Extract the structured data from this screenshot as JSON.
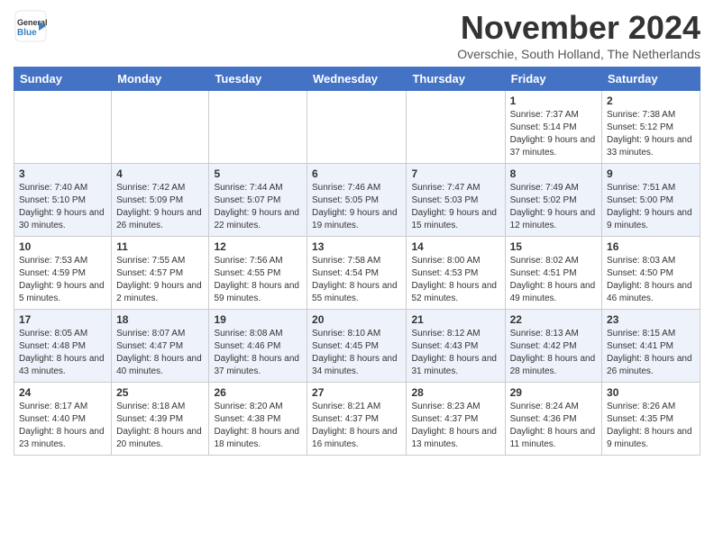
{
  "header": {
    "logo_general": "General",
    "logo_blue": "Blue",
    "month_title": "November 2024",
    "subtitle": "Overschie, South Holland, The Netherlands"
  },
  "days_of_week": [
    "Sunday",
    "Monday",
    "Tuesday",
    "Wednesday",
    "Thursday",
    "Friday",
    "Saturday"
  ],
  "weeks": [
    [
      {
        "day": "",
        "info": ""
      },
      {
        "day": "",
        "info": ""
      },
      {
        "day": "",
        "info": ""
      },
      {
        "day": "",
        "info": ""
      },
      {
        "day": "",
        "info": ""
      },
      {
        "day": "1",
        "info": "Sunrise: 7:37 AM\nSunset: 5:14 PM\nDaylight: 9 hours and 37 minutes."
      },
      {
        "day": "2",
        "info": "Sunrise: 7:38 AM\nSunset: 5:12 PM\nDaylight: 9 hours and 33 minutes."
      }
    ],
    [
      {
        "day": "3",
        "info": "Sunrise: 7:40 AM\nSunset: 5:10 PM\nDaylight: 9 hours and 30 minutes."
      },
      {
        "day": "4",
        "info": "Sunrise: 7:42 AM\nSunset: 5:09 PM\nDaylight: 9 hours and 26 minutes."
      },
      {
        "day": "5",
        "info": "Sunrise: 7:44 AM\nSunset: 5:07 PM\nDaylight: 9 hours and 22 minutes."
      },
      {
        "day": "6",
        "info": "Sunrise: 7:46 AM\nSunset: 5:05 PM\nDaylight: 9 hours and 19 minutes."
      },
      {
        "day": "7",
        "info": "Sunrise: 7:47 AM\nSunset: 5:03 PM\nDaylight: 9 hours and 15 minutes."
      },
      {
        "day": "8",
        "info": "Sunrise: 7:49 AM\nSunset: 5:02 PM\nDaylight: 9 hours and 12 minutes."
      },
      {
        "day": "9",
        "info": "Sunrise: 7:51 AM\nSunset: 5:00 PM\nDaylight: 9 hours and 9 minutes."
      }
    ],
    [
      {
        "day": "10",
        "info": "Sunrise: 7:53 AM\nSunset: 4:59 PM\nDaylight: 9 hours and 5 minutes."
      },
      {
        "day": "11",
        "info": "Sunrise: 7:55 AM\nSunset: 4:57 PM\nDaylight: 9 hours and 2 minutes."
      },
      {
        "day": "12",
        "info": "Sunrise: 7:56 AM\nSunset: 4:55 PM\nDaylight: 8 hours and 59 minutes."
      },
      {
        "day": "13",
        "info": "Sunrise: 7:58 AM\nSunset: 4:54 PM\nDaylight: 8 hours and 55 minutes."
      },
      {
        "day": "14",
        "info": "Sunrise: 8:00 AM\nSunset: 4:53 PM\nDaylight: 8 hours and 52 minutes."
      },
      {
        "day": "15",
        "info": "Sunrise: 8:02 AM\nSunset: 4:51 PM\nDaylight: 8 hours and 49 minutes."
      },
      {
        "day": "16",
        "info": "Sunrise: 8:03 AM\nSunset: 4:50 PM\nDaylight: 8 hours and 46 minutes."
      }
    ],
    [
      {
        "day": "17",
        "info": "Sunrise: 8:05 AM\nSunset: 4:48 PM\nDaylight: 8 hours and 43 minutes."
      },
      {
        "day": "18",
        "info": "Sunrise: 8:07 AM\nSunset: 4:47 PM\nDaylight: 8 hours and 40 minutes."
      },
      {
        "day": "19",
        "info": "Sunrise: 8:08 AM\nSunset: 4:46 PM\nDaylight: 8 hours and 37 minutes."
      },
      {
        "day": "20",
        "info": "Sunrise: 8:10 AM\nSunset: 4:45 PM\nDaylight: 8 hours and 34 minutes."
      },
      {
        "day": "21",
        "info": "Sunrise: 8:12 AM\nSunset: 4:43 PM\nDaylight: 8 hours and 31 minutes."
      },
      {
        "day": "22",
        "info": "Sunrise: 8:13 AM\nSunset: 4:42 PM\nDaylight: 8 hours and 28 minutes."
      },
      {
        "day": "23",
        "info": "Sunrise: 8:15 AM\nSunset: 4:41 PM\nDaylight: 8 hours and 26 minutes."
      }
    ],
    [
      {
        "day": "24",
        "info": "Sunrise: 8:17 AM\nSunset: 4:40 PM\nDaylight: 8 hours and 23 minutes."
      },
      {
        "day": "25",
        "info": "Sunrise: 8:18 AM\nSunset: 4:39 PM\nDaylight: 8 hours and 20 minutes."
      },
      {
        "day": "26",
        "info": "Sunrise: 8:20 AM\nSunset: 4:38 PM\nDaylight: 8 hours and 18 minutes."
      },
      {
        "day": "27",
        "info": "Sunrise: 8:21 AM\nSunset: 4:37 PM\nDaylight: 8 hours and 16 minutes."
      },
      {
        "day": "28",
        "info": "Sunrise: 8:23 AM\nSunset: 4:37 PM\nDaylight: 8 hours and 13 minutes."
      },
      {
        "day": "29",
        "info": "Sunrise: 8:24 AM\nSunset: 4:36 PM\nDaylight: 8 hours and 11 minutes."
      },
      {
        "day": "30",
        "info": "Sunrise: 8:26 AM\nSunset: 4:35 PM\nDaylight: 8 hours and 9 minutes."
      }
    ]
  ]
}
